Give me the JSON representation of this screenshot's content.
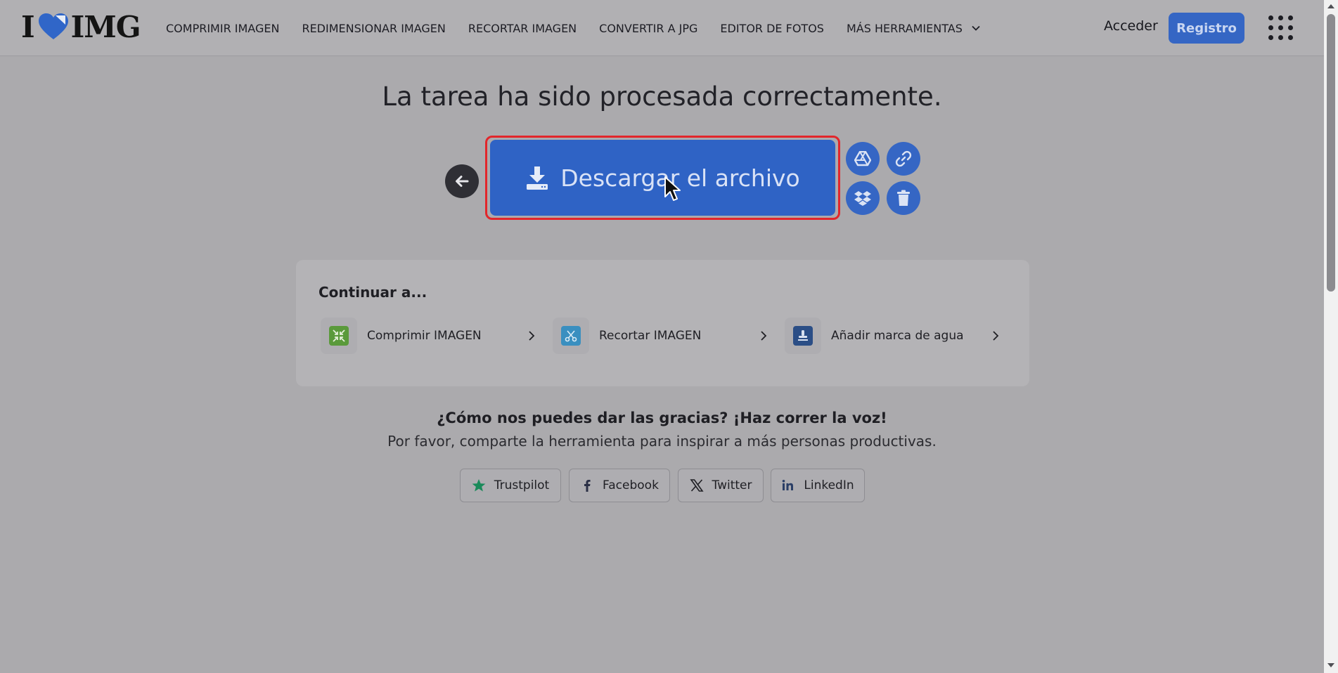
{
  "header": {
    "logo_left": "I",
    "logo_right": "IMG",
    "nav": [
      {
        "label": "COMPRIMIR IMAGEN"
      },
      {
        "label": "REDIMENSIONAR IMAGEN"
      },
      {
        "label": "RECORTAR IMAGEN"
      },
      {
        "label": "CONVERTIR A JPG"
      },
      {
        "label": "EDITOR DE FOTOS"
      },
      {
        "label": "MÁS HERRAMIENTAS"
      }
    ],
    "login_label": "Acceder",
    "register_label": "Registro"
  },
  "main": {
    "title": "La tarea ha sido procesada correctamente.",
    "download_label": "Descargar el archivo"
  },
  "continue": {
    "title": "Continuar a...",
    "tools": [
      {
        "label": "Comprimir IMAGEN",
        "icon": "compress-icon",
        "color": "#5a9a3b"
      },
      {
        "label": "Recortar IMAGEN",
        "icon": "scissors-icon",
        "color": "#3a8fc0"
      },
      {
        "label": "Añadir marca de agua",
        "icon": "stamp-icon",
        "color": "#2b4e86"
      }
    ]
  },
  "share": {
    "title": "¿Cómo nos puedes dar las gracias? ¡Haz correr la voz!",
    "subtitle": "Por favor, comparte la herramienta para inspirar a más personas productivas.",
    "buttons": [
      {
        "label": "Trustpilot",
        "icon": "star-icon"
      },
      {
        "label": "Facebook",
        "icon": "facebook-icon"
      },
      {
        "label": "Twitter",
        "icon": "x-icon"
      },
      {
        "label": "LinkedIn",
        "icon": "linkedin-icon"
      }
    ]
  },
  "colors": {
    "accent": "#3566c4",
    "highlight": "#e2262b",
    "background": "#abaaad"
  }
}
